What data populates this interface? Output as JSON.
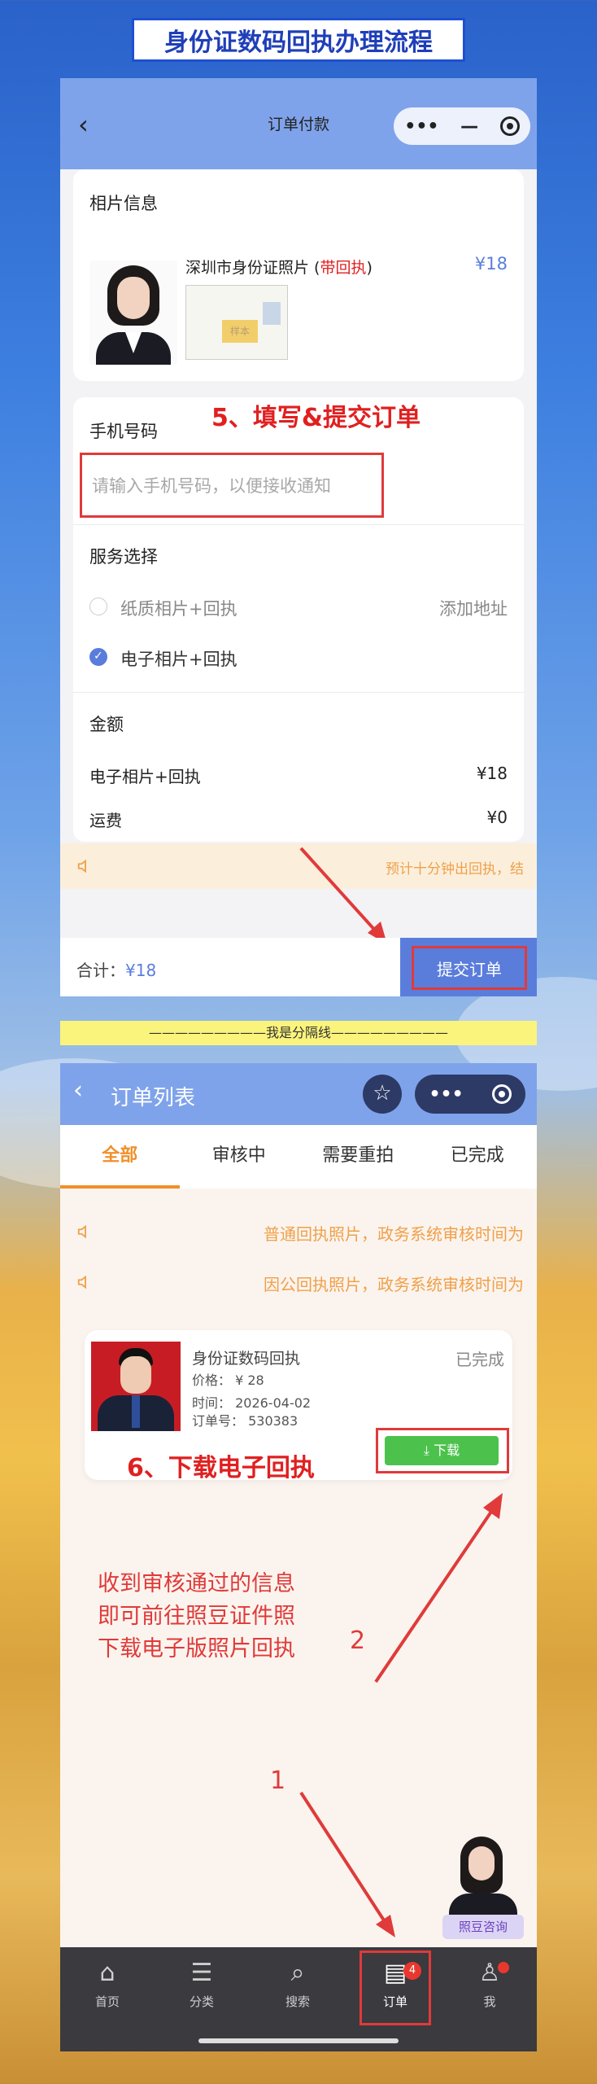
{
  "header": {
    "title": "身份证数码回执办理流程"
  },
  "screen1": {
    "nav_back": "‹",
    "nav_title": "订单付款",
    "capsule_dots": "•••",
    "capsule_minus": "—",
    "photo_section_title": "相片信息",
    "product_name": "深圳市身份证照片 (",
    "product_tag": "带回执",
    "product_close": ")",
    "product_price": "¥18",
    "stamp_text": "样本",
    "step5": "5、填写&提交订单",
    "phone_label": "手机号码",
    "phone_placeholder": "请输入手机号码，以便接收通知",
    "service_label": "服务选择",
    "option1": "纸质相片+回执",
    "option1_extra": "添加地址",
    "option2": "电子相片+回执",
    "amount_label": "金额",
    "amount_item": "电子相片+回执",
    "amount_item_value": "¥18",
    "shipping_label": "运费",
    "shipping_value": "¥0",
    "notice": "预计十分钟出回执，结",
    "total_label": "合计：",
    "total_value": "¥18",
    "submit_label": "提交订单"
  },
  "separator": "—————————我是分隔线—————————",
  "screen2": {
    "nav_back": "‹",
    "nav_title": "订单列表",
    "star": "☆",
    "capsule_dots": "•••",
    "tabs": [
      "全部",
      "审核中",
      "需要重拍",
      "已完成"
    ],
    "notice1": "普通回执照片，政务系统审核时间为",
    "notice2": "因公回执照片，政务系统审核时间为",
    "order_title": "身份证数码回执",
    "order_status": "已完成",
    "order_price": "价格： ¥ 28",
    "order_time": "时间： 2026-04-02",
    "order_no": "订单号： 530383",
    "download_label": "⤓ 下载",
    "step6": "6、下载电子回执",
    "note_line1": "收到审核通过的信息",
    "note_line2": "即可前往照豆证件照",
    "note_line3": "下载电子版照片回执",
    "num2": "2",
    "num1": "1",
    "consult_label": "照豆咨询",
    "tabbar": {
      "home": "首页",
      "category": "分类",
      "search": "搜索",
      "order": "订单",
      "me": "我",
      "order_badge": "4"
    }
  },
  "colors": {
    "accent": "#7fa3ea",
    "highlight": "#e03a3a",
    "orange": "#f0902a",
    "green": "#4cc24c"
  }
}
